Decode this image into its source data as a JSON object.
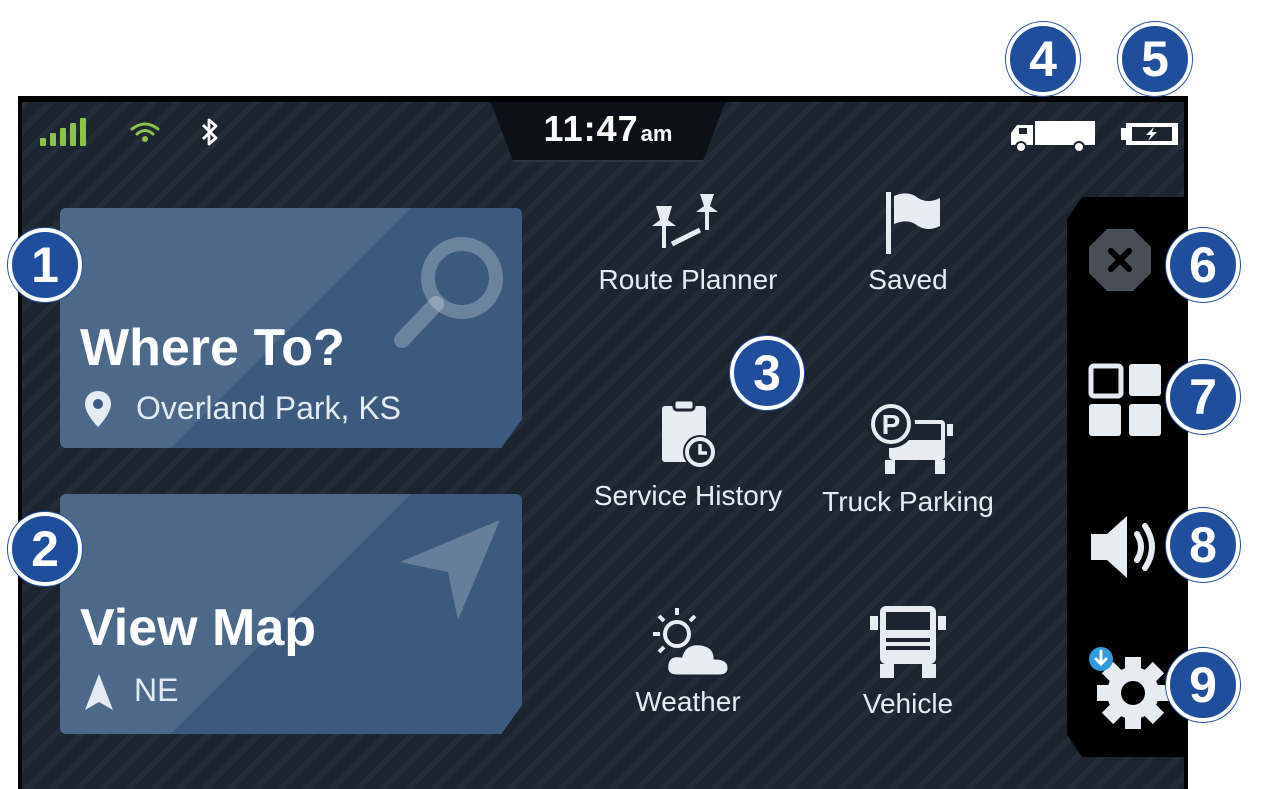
{
  "status_bar": {
    "time": "11:47",
    "ampm": "am",
    "signal_icon": "cell-signal-icon",
    "wifi_icon": "wifi-icon",
    "bluetooth_icon": "bluetooth-icon",
    "vehicle_icon": "truck-icon",
    "battery_icon": "battery-charging-icon"
  },
  "tiles": {
    "where_to": {
      "title": "Where To?",
      "location": "Overland Park, KS"
    },
    "view_map": {
      "title": "View Map",
      "heading": "NE"
    }
  },
  "apps": [
    {
      "label": "Route Planner",
      "icon": "route-planner-icon"
    },
    {
      "label": "Saved",
      "icon": "flag-icon"
    },
    {
      "label": "Service History",
      "icon": "service-history-icon"
    },
    {
      "label": "Truck Parking",
      "icon": "truck-parking-icon"
    },
    {
      "label": "Weather",
      "icon": "weather-icon"
    },
    {
      "label": "Vehicle",
      "icon": "vehicle-icon"
    }
  ],
  "side_panel": [
    {
      "icon": "close-icon"
    },
    {
      "icon": "app-grid-icon"
    },
    {
      "icon": "volume-icon"
    },
    {
      "icon": "settings-icon"
    }
  ],
  "callouts": [
    "1",
    "2",
    "3",
    "4",
    "5",
    "6",
    "7",
    "8",
    "9"
  ],
  "colors": {
    "callout": "#1f4e9c",
    "tile": "#3b5a7e",
    "signal": "#8bc34a",
    "screen_bg": "#1c2430"
  }
}
